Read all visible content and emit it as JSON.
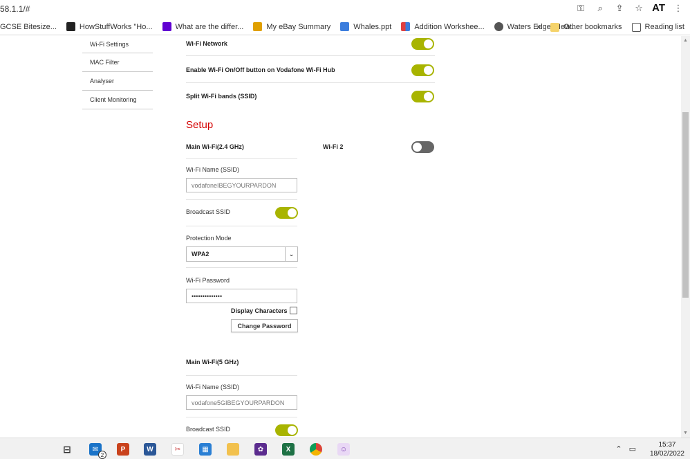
{
  "browser": {
    "url": "58.1.1/#",
    "initials": "AT",
    "icons": [
      "key-icon",
      "zoom-icon",
      "share-icon",
      "star-icon",
      "menu-icon"
    ]
  },
  "bookmarks": {
    "items": [
      {
        "label": "GCSE Bitesize...",
        "icon": "bitesize-icon",
        "color": "#ffffff"
      },
      {
        "label": "HowStuffWorks \"Ho...",
        "icon": "howstuffworks-icon",
        "color": "#222222"
      },
      {
        "label": "What are the differ...",
        "icon": "yahoo-icon",
        "color": "#6001d2"
      },
      {
        "label": "My eBay Summary",
        "icon": "ebay-icon",
        "color": "#e0a000"
      },
      {
        "label": "Whales.ppt",
        "icon": "ppt-icon",
        "color": "#3b7ddd"
      },
      {
        "label": "Addition Workshee...",
        "icon": "worksheet-icon",
        "color": "#e04040"
      },
      {
        "label": "Waters Edge: New...",
        "icon": "globe-icon",
        "color": "#555555"
      }
    ],
    "overflow": "»",
    "other": "Other bookmarks",
    "reading": "Reading list"
  },
  "sidebar": {
    "items": [
      "Wi-Fi Settings",
      "MAC Filter",
      "Analyser",
      "Client Monitoring"
    ]
  },
  "settings": {
    "wifi_network": "Wi-Fi Network",
    "enable_button": "Enable Wi-Fi On/Off button on Vodafone Wi-Fi Hub",
    "split_bands": "Split Wi-Fi bands (SSID)"
  },
  "setup": {
    "title": "Setup",
    "wifi2_label": "Wi-Fi 2",
    "band24": {
      "title": "Main Wi-Fi(2.4 GHz)",
      "ssid_label": "Wi-Fi Name (SSID)",
      "ssid_value": "vodafoneIBEGYOURPARDON",
      "broadcast_label": "Broadcast SSID",
      "protection_label": "Protection Mode",
      "protection_value": "WPA2",
      "password_label": "Wi-Fi Password",
      "password_value": "••••••••••••••",
      "display_chars": "Display Characters",
      "change_password": "Change Password"
    },
    "band5": {
      "title": "Main Wi-Fi(5 GHz)",
      "ssid_label": "Wi-Fi Name (SSID)",
      "ssid_value": "vodafone5GIBEGYOURPARDON",
      "broadcast_label": "Broadcast SSID"
    }
  },
  "colors": {
    "accent": "#a8b400",
    "section_title": "#d40000",
    "toggle_off": "#666666"
  },
  "taskbar": {
    "mail_badge": "2",
    "time": "15:37",
    "date": "18/02/2022"
  }
}
